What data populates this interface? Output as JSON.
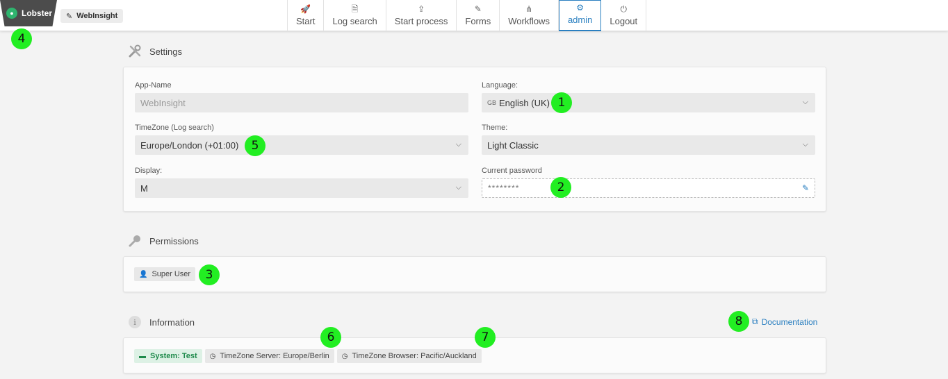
{
  "brand": {
    "logo_text": "Lobster",
    "app_chip": "WebInsight"
  },
  "nav": [
    {
      "label": "Start",
      "icon": "rocket-icon",
      "glyph": "🚀"
    },
    {
      "label": "Log search",
      "icon": "log-search-icon",
      "glyph": "🗎"
    },
    {
      "label": "Start process",
      "icon": "upload-icon",
      "glyph": "⇪"
    },
    {
      "label": "Forms",
      "icon": "edit-icon",
      "glyph": "✎"
    },
    {
      "label": "Workflows",
      "icon": "workflow-icon",
      "glyph": "⋔"
    },
    {
      "label": "admin",
      "icon": "user-gear-icon",
      "glyph": "⚙",
      "active": true
    },
    {
      "label": "Logout",
      "icon": "power-icon",
      "glyph": "⏻"
    }
  ],
  "settings": {
    "title": "Settings",
    "app_name": {
      "label": "App-Name",
      "value": "WebInsight"
    },
    "language": {
      "label": "Language:",
      "flag": "GB",
      "value": "English (UK)"
    },
    "timezone": {
      "label": "TimeZone (Log search)",
      "value": "Europe/London (+01:00)"
    },
    "theme": {
      "label": "Theme:",
      "value": "Light Classic"
    },
    "display": {
      "label": "Display:",
      "value": "M"
    },
    "password": {
      "label": "Current password",
      "value": "********"
    }
  },
  "permissions": {
    "title": "Permissions",
    "role": "Super User"
  },
  "information": {
    "title": "Information",
    "doc_link": "Documentation",
    "system": "System: Test",
    "tz_server": "TimeZone Server: Europe/Berlin",
    "tz_browser": "TimeZone Browser: Pacific/Auckland"
  },
  "markers": [
    "1",
    "2",
    "3",
    "4",
    "5",
    "6",
    "7",
    "8"
  ],
  "colors": {
    "accent": "#2a7fc0",
    "marker": "#22ee22",
    "system_green": "#1e8a4b"
  }
}
